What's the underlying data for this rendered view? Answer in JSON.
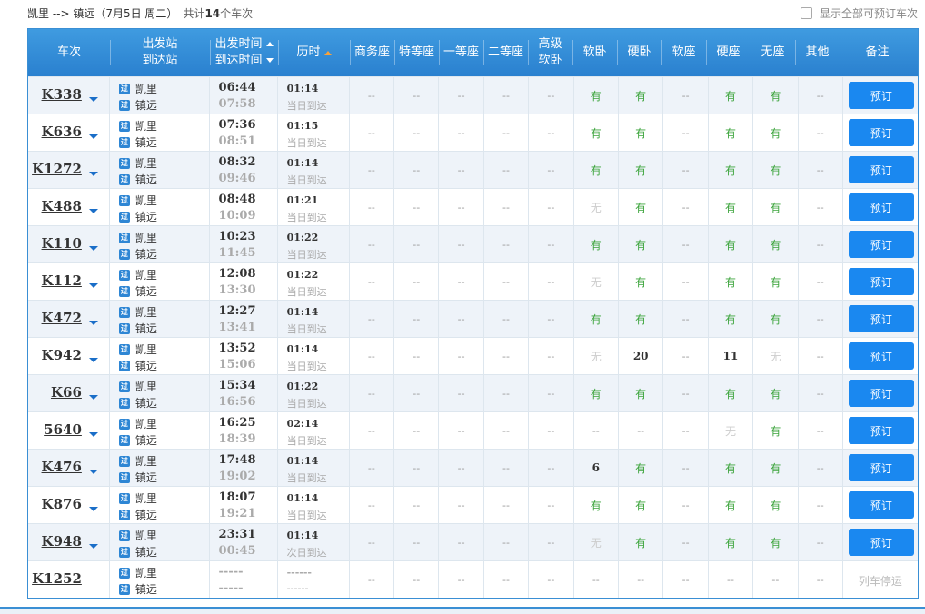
{
  "header": {
    "route": "凯里 --> 镇远（7月5日 周二）",
    "total_prefix": "共计",
    "total_count": "14",
    "total_suffix": "个车次",
    "show_all_label": "显示全部可预订车次"
  },
  "columns": {
    "train": "车次",
    "from": "出发站",
    "to": "到达站",
    "dep_time": "出发时间",
    "arr_time": "到达时间",
    "duration": "历时",
    "business": "商务座",
    "premium": "特等座",
    "first": "一等座",
    "second": "二等座",
    "deluxe_soft_1": "高级",
    "deluxe_soft_2": "软卧",
    "soft_sleeper": "软卧",
    "hard_sleeper": "硬卧",
    "soft_seat": "软座",
    "hard_seat": "硬座",
    "no_seat": "无座",
    "other": "其他",
    "remark": "备注"
  },
  "colors": {
    "header_bg": "#2a80cf",
    "available": "#3ca43c",
    "book_button": "#1a88f0"
  },
  "book_label": "预订",
  "trains": [
    {
      "no": "K338",
      "from": "凯里",
      "to": "镇远",
      "dep": "06:44",
      "arr": "07:58",
      "dur": "01:14",
      "note": "当日到达",
      "seats": [
        "--",
        "--",
        "--",
        "--",
        "--",
        "有",
        "有",
        "--",
        "有",
        "有",
        "--"
      ],
      "remark": "预订"
    },
    {
      "no": "K636",
      "from": "凯里",
      "to": "镇远",
      "dep": "07:36",
      "arr": "08:51",
      "dur": "01:15",
      "note": "当日到达",
      "seats": [
        "--",
        "--",
        "--",
        "--",
        "--",
        "有",
        "有",
        "--",
        "有",
        "有",
        "--"
      ],
      "remark": "预订"
    },
    {
      "no": "K1272",
      "from": "凯里",
      "to": "镇远",
      "dep": "08:32",
      "arr": "09:46",
      "dur": "01:14",
      "note": "当日到达",
      "seats": [
        "--",
        "--",
        "--",
        "--",
        "--",
        "有",
        "有",
        "--",
        "有",
        "有",
        "--"
      ],
      "remark": "预订"
    },
    {
      "no": "K488",
      "from": "凯里",
      "to": "镇远",
      "dep": "08:48",
      "arr": "10:09",
      "dur": "01:21",
      "note": "当日到达",
      "seats": [
        "--",
        "--",
        "--",
        "--",
        "--",
        "无",
        "有",
        "--",
        "有",
        "有",
        "--"
      ],
      "remark": "预订"
    },
    {
      "no": "K110",
      "from": "凯里",
      "to": "镇远",
      "dep": "10:23",
      "arr": "11:45",
      "dur": "01:22",
      "note": "当日到达",
      "seats": [
        "--",
        "--",
        "--",
        "--",
        "--",
        "有",
        "有",
        "--",
        "有",
        "有",
        "--"
      ],
      "remark": "预订"
    },
    {
      "no": "K112",
      "from": "凯里",
      "to": "镇远",
      "dep": "12:08",
      "arr": "13:30",
      "dur": "01:22",
      "note": "当日到达",
      "seats": [
        "--",
        "--",
        "--",
        "--",
        "--",
        "无",
        "有",
        "--",
        "有",
        "有",
        "--"
      ],
      "remark": "预订"
    },
    {
      "no": "K472",
      "from": "凯里",
      "to": "镇远",
      "dep": "12:27",
      "arr": "13:41",
      "dur": "01:14",
      "note": "当日到达",
      "seats": [
        "--",
        "--",
        "--",
        "--",
        "--",
        "有",
        "有",
        "--",
        "有",
        "有",
        "--"
      ],
      "remark": "预订"
    },
    {
      "no": "K942",
      "from": "凯里",
      "to": "镇远",
      "dep": "13:52",
      "arr": "15:06",
      "dur": "01:14",
      "note": "当日到达",
      "seats": [
        "--",
        "--",
        "--",
        "--",
        "--",
        "无",
        "20",
        "--",
        "11",
        "无",
        "--"
      ],
      "remark": "预订"
    },
    {
      "no": "K66",
      "from": "凯里",
      "to": "镇远",
      "dep": "15:34",
      "arr": "16:56",
      "dur": "01:22",
      "note": "当日到达",
      "seats": [
        "--",
        "--",
        "--",
        "--",
        "--",
        "有",
        "有",
        "--",
        "有",
        "有",
        "--"
      ],
      "remark": "预订"
    },
    {
      "no": "5640",
      "from": "凯里",
      "to": "镇远",
      "dep": "16:25",
      "arr": "18:39",
      "dur": "02:14",
      "note": "当日到达",
      "seats": [
        "--",
        "--",
        "--",
        "--",
        "--",
        "--",
        "--",
        "--",
        "无",
        "有",
        "--"
      ],
      "remark": "预订"
    },
    {
      "no": "K476",
      "from": "凯里",
      "to": "镇远",
      "dep": "17:48",
      "arr": "19:02",
      "dur": "01:14",
      "note": "当日到达",
      "seats": [
        "--",
        "--",
        "--",
        "--",
        "--",
        "6",
        "有",
        "--",
        "有",
        "有",
        "--"
      ],
      "remark": "预订"
    },
    {
      "no": "K876",
      "from": "凯里",
      "to": "镇远",
      "dep": "18:07",
      "arr": "19:21",
      "dur": "01:14",
      "note": "当日到达",
      "seats": [
        "--",
        "--",
        "--",
        "--",
        "--",
        "有",
        "有",
        "--",
        "有",
        "有",
        "--"
      ],
      "remark": "预订"
    },
    {
      "no": "K948",
      "from": "凯里",
      "to": "镇远",
      "dep": "23:31",
      "arr": "00:45",
      "dur": "01:14",
      "note": "次日到达",
      "seats": [
        "--",
        "--",
        "--",
        "--",
        "--",
        "无",
        "有",
        "--",
        "有",
        "有",
        "--"
      ],
      "remark": "预订"
    },
    {
      "no": "K1252",
      "from": "凯里",
      "to": "镇远",
      "dep": "-----",
      "arr": "-----",
      "dur": "------",
      "note": "------",
      "seats": [
        "--",
        "--",
        "--",
        "--",
        "--",
        "--",
        "--",
        "--",
        "--",
        "--",
        "--"
      ],
      "remark": "列车停运"
    }
  ]
}
